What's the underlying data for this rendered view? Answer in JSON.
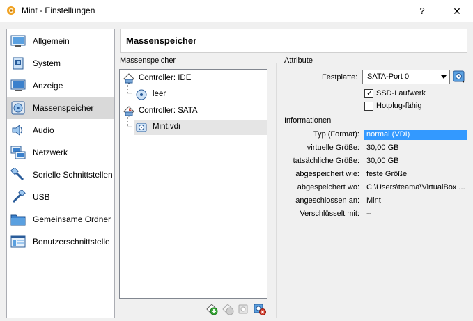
{
  "window": {
    "title": "Mint - Einstellungen",
    "help_label": "?",
    "close_label": "✕"
  },
  "sidebar": {
    "items": [
      {
        "label": "Allgemein",
        "icon": "general-icon"
      },
      {
        "label": "System",
        "icon": "system-icon"
      },
      {
        "label": "Anzeige",
        "icon": "display-icon"
      },
      {
        "label": "Massenspeicher",
        "icon": "storage-icon",
        "selected": true
      },
      {
        "label": "Audio",
        "icon": "audio-icon"
      },
      {
        "label": "Netzwerk",
        "icon": "network-icon"
      },
      {
        "label": "Serielle Schnittstellen",
        "icon": "serial-port-icon"
      },
      {
        "label": "USB",
        "icon": "usb-icon"
      },
      {
        "label": "Gemeinsame Ordner",
        "icon": "shared-folder-icon"
      },
      {
        "label": "Benutzerschnittstelle",
        "icon": "user-interface-icon"
      }
    ]
  },
  "page": {
    "title": "Massenspeicher"
  },
  "storage": {
    "group_label": "Massenspeicher",
    "tree": [
      {
        "label": "Controller: IDE",
        "icon": "ide-controller-icon"
      },
      {
        "label": "leer",
        "icon": "optical-disc-icon"
      },
      {
        "label": "Controller: SATA",
        "icon": "sata-controller-icon"
      },
      {
        "label": "Mint.vdi",
        "icon": "hard-disk-icon",
        "selected": true
      }
    ]
  },
  "attributes": {
    "group_label": "Attribute",
    "port_label": "Festplatte:",
    "port_value": "SATA-Port 0",
    "ssd_label": "SSD-Laufwerk",
    "ssd_checked": true,
    "hotplug_label": "Hotplug-fähig",
    "hotplug_checked": false
  },
  "information": {
    "group_label": "Informationen",
    "rows": [
      {
        "label": "Typ (Format):",
        "value": "normal (VDI)"
      },
      {
        "label": "virtuelle Größe:",
        "value": "30,00 GB"
      },
      {
        "label": "tatsächliche Größe:",
        "value": "30,00 GB"
      },
      {
        "label": "abgespeichert wie:",
        "value": "feste Größe"
      },
      {
        "label": "abgespeichert wo:",
        "value": "C:\\Users\\teama\\VirtualBox ..."
      },
      {
        "label": "angeschlossen an:",
        "value": "Mint"
      },
      {
        "label": "Verschlüsselt mit:",
        "value": "--"
      }
    ]
  },
  "colors": {
    "selection": "#3399ff",
    "sidebar_selected": "#d9d9d9"
  }
}
